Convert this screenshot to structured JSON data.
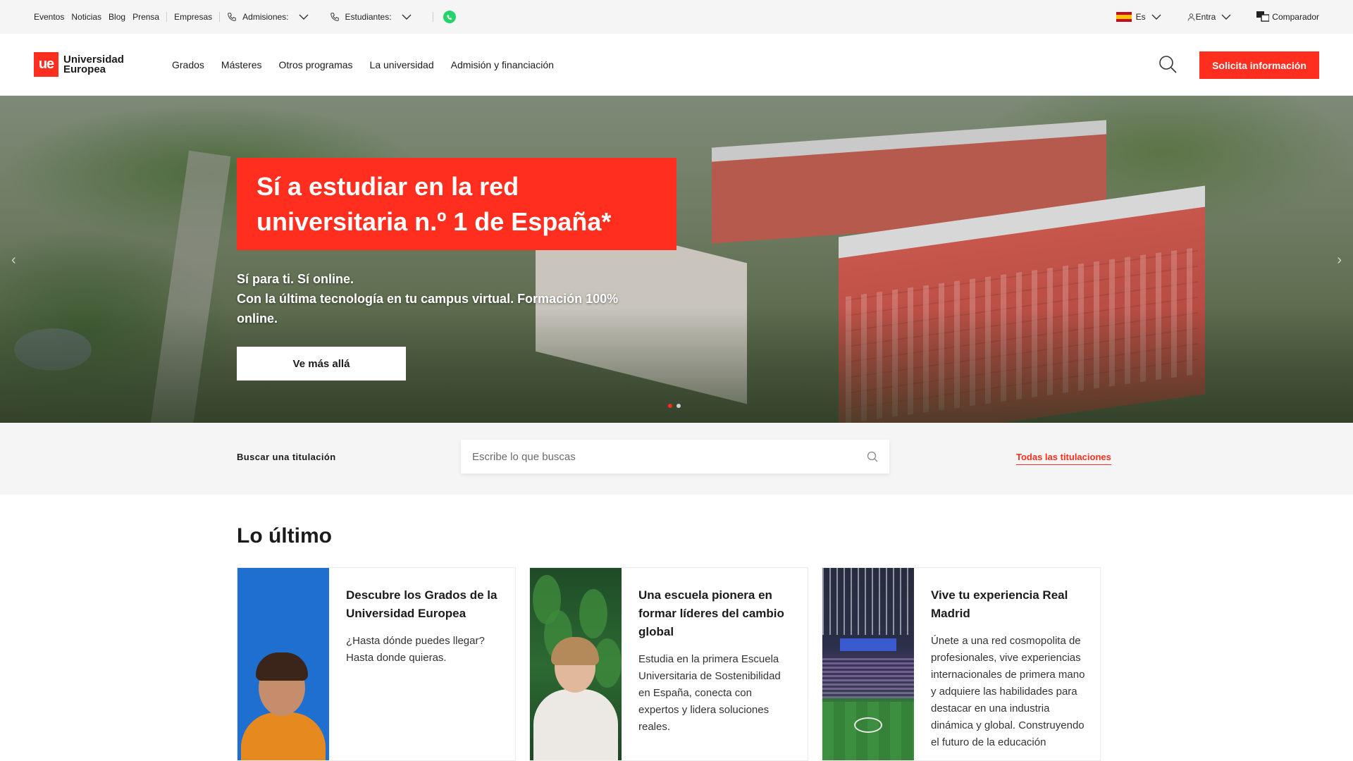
{
  "topbar": {
    "links": [
      "Eventos",
      "Noticias",
      "Blog",
      "Prensa",
      "Empresas"
    ],
    "admisiones_label": "Admisiones:",
    "estudiantes_label": "Estudiantes:",
    "language": "Es",
    "login": "Entra",
    "comparador": "Comparador"
  },
  "brand": {
    "mark": "ue",
    "line1": "Universidad",
    "line2": "Europea",
    "accent_color": "#ff2e1f"
  },
  "nav": {
    "items": [
      "Grados",
      "Másteres",
      "Otros programas",
      "La universidad",
      "Admisión y financiación"
    ],
    "cta": "Solicita información"
  },
  "hero": {
    "title": "Sí a estudiar en la red universitaria n.º 1 de España*",
    "subtitle_line1": "Sí para ti. Sí online.",
    "subtitle_line2": "Con la última tecnología en tu campus virtual. Formación 100% online.",
    "button": "Ve más allá",
    "slides_total": 2,
    "slide_active": 1
  },
  "search": {
    "label": "Buscar una titulación",
    "placeholder": "Escribe lo que buscas",
    "all_link": "Todas las titulaciones"
  },
  "latest": {
    "title": "Lo último",
    "cards": [
      {
        "title": "Descubre los Grados de la Universidad Europea",
        "text": "¿Hasta dónde puedes llegar? Hasta donde quieras."
      },
      {
        "title": "Una escuela pionera en formar líderes del cambio global",
        "text": "Estudia en la primera Escuela Universitaria de Sostenibilidad en España, conecta con expertos y lidera soluciones reales."
      },
      {
        "title": "Vive tu experiencia Real Madrid",
        "text": "Únete a una red cosmopolita de profesionales, vive experiencias internacionales de primera mano y adquiere las habilidades para destacar en una industria dinámica y global. Construyendo el futuro de la educación"
      }
    ]
  }
}
